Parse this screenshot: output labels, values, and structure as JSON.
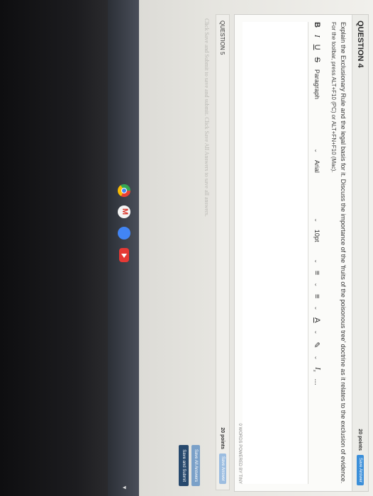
{
  "question4": {
    "title": "QUESTION 4",
    "points": "20 points",
    "save_answer": "Save Answer",
    "prompt": "Explain the Exclusionary Rule and the legal basis for it. Discuss the importance of the 'fruits of the poisonous tree' doctrine as it relates to the exclusion of evidence.",
    "toolbar_hint": "For the toolbar, press ALT+F10 (PC) or ALT+FN+F10 (Mac).",
    "toolbar": {
      "bold": "B",
      "italic": "I",
      "underline": "U",
      "strike": "S",
      "paragraph": "Paragraph",
      "font": "Arial",
      "size": "10pt",
      "more": "..."
    },
    "word_count": "0 WORDS   POWERED BY TINY"
  },
  "question5": {
    "title": "QUESTION 5",
    "points": "20 points",
    "save_answer": "Save Answer"
  },
  "footer": {
    "instruction": "Click Save and Submit to save and submit. Click Save All Answers to save all answers.",
    "save_all": "Save All Answers",
    "save_submit": "Save and Submit"
  },
  "taskbar": {
    "icons": [
      "chrome-icon",
      "gmail-icon",
      "docs-icon",
      "youtube-icon"
    ]
  }
}
